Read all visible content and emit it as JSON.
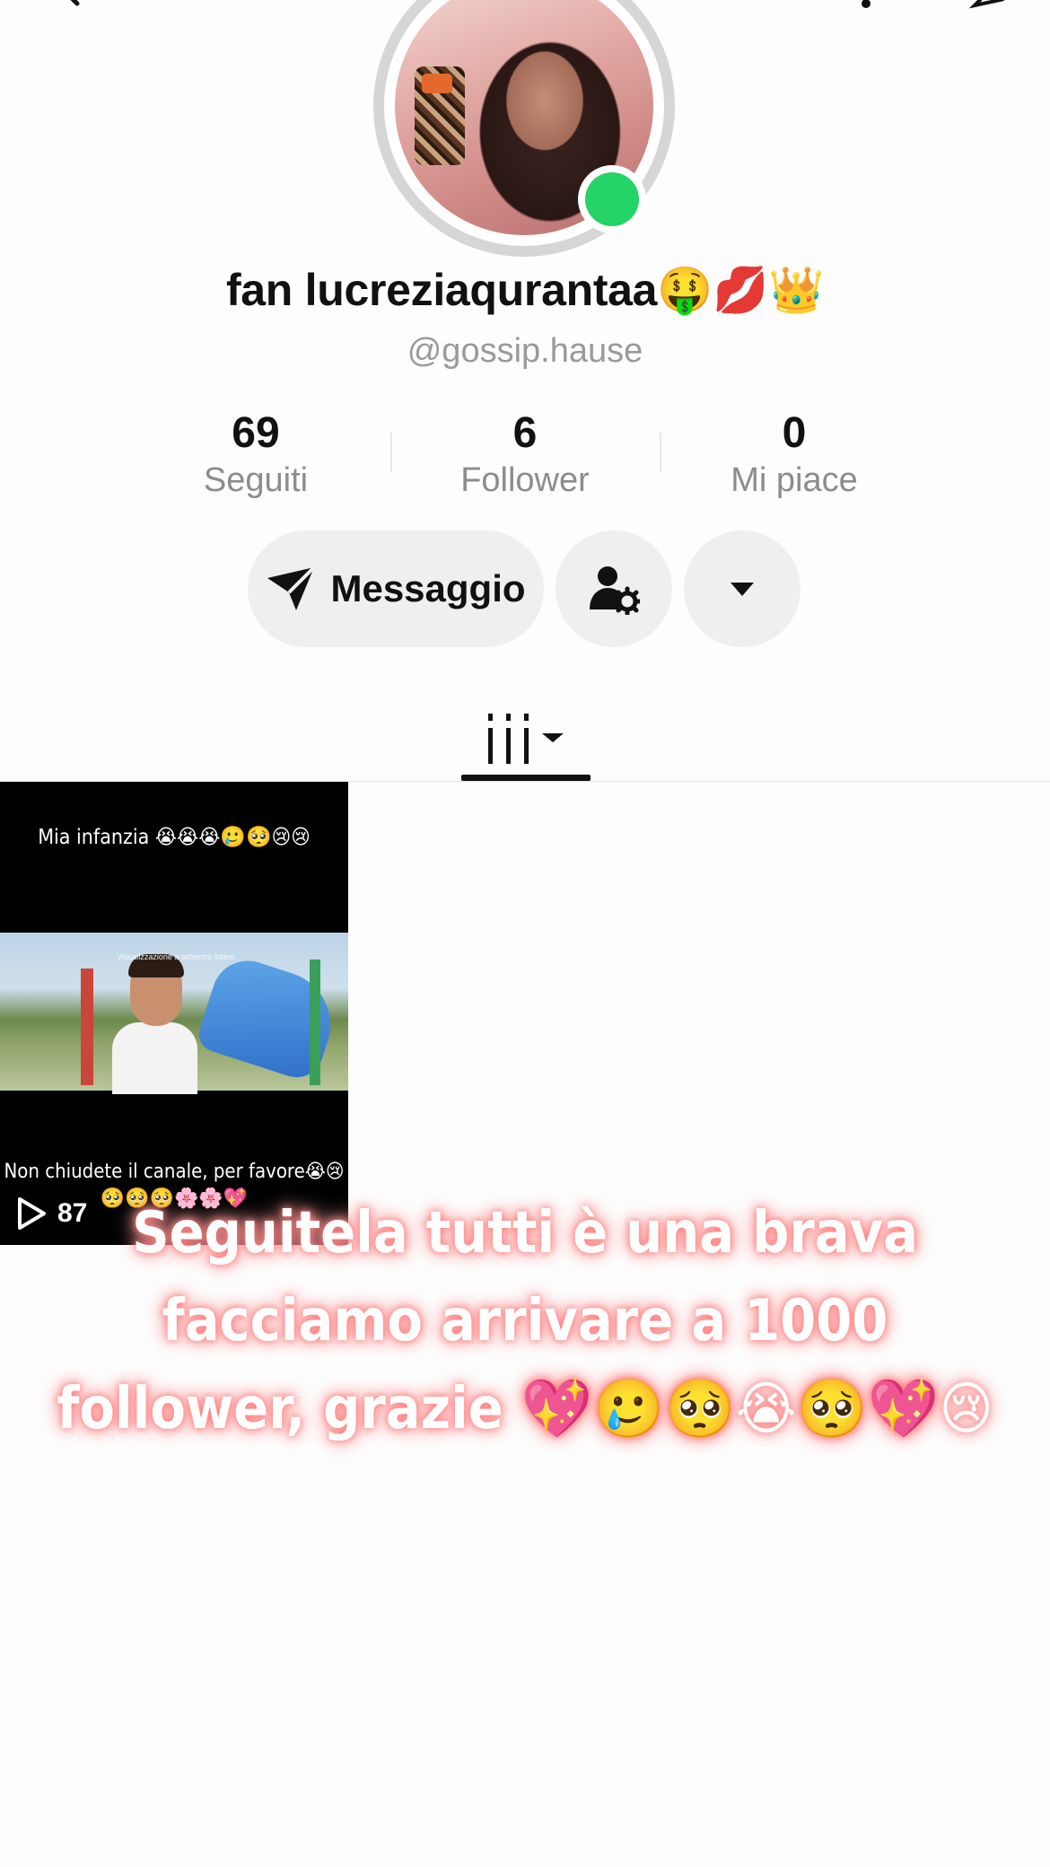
{
  "icons": {
    "back": "chevron-left-icon",
    "top_right_a": "bell-icon",
    "top_right_b": "share-icon",
    "send": "send-icon",
    "follow_settings": "user-gear-icon",
    "more": "caret-down-icon",
    "videos_tab": "grid-bars-icon",
    "play": "play-icon"
  },
  "profile": {
    "display_name": "fan lucreziaqurantaa🤑💋👑",
    "handle": "@gossip.hause",
    "online_color": "#25d366"
  },
  "stats": [
    {
      "value": "69",
      "label": "Seguiti"
    },
    {
      "value": "6",
      "label": "Follower"
    },
    {
      "value": "0",
      "label": "Mi piace"
    }
  ],
  "actions": {
    "message_label": "Messaggio"
  },
  "videos": [
    {
      "top_caption": "Mia infanzia 😭😭😭🥲🥺😢😢",
      "scene_caption": "Visualizzazione a schermo intero",
      "bottom_caption": "Non chiudete il canale, per favore😭😢🥺🥺🥺🌸🌸💖",
      "views": "87"
    }
  ],
  "overlay_caption": "Seguitela tutti è una brava facciamo arrivare a 1000 follower, grazie 💖🥲🥺😭🥺💖😢"
}
